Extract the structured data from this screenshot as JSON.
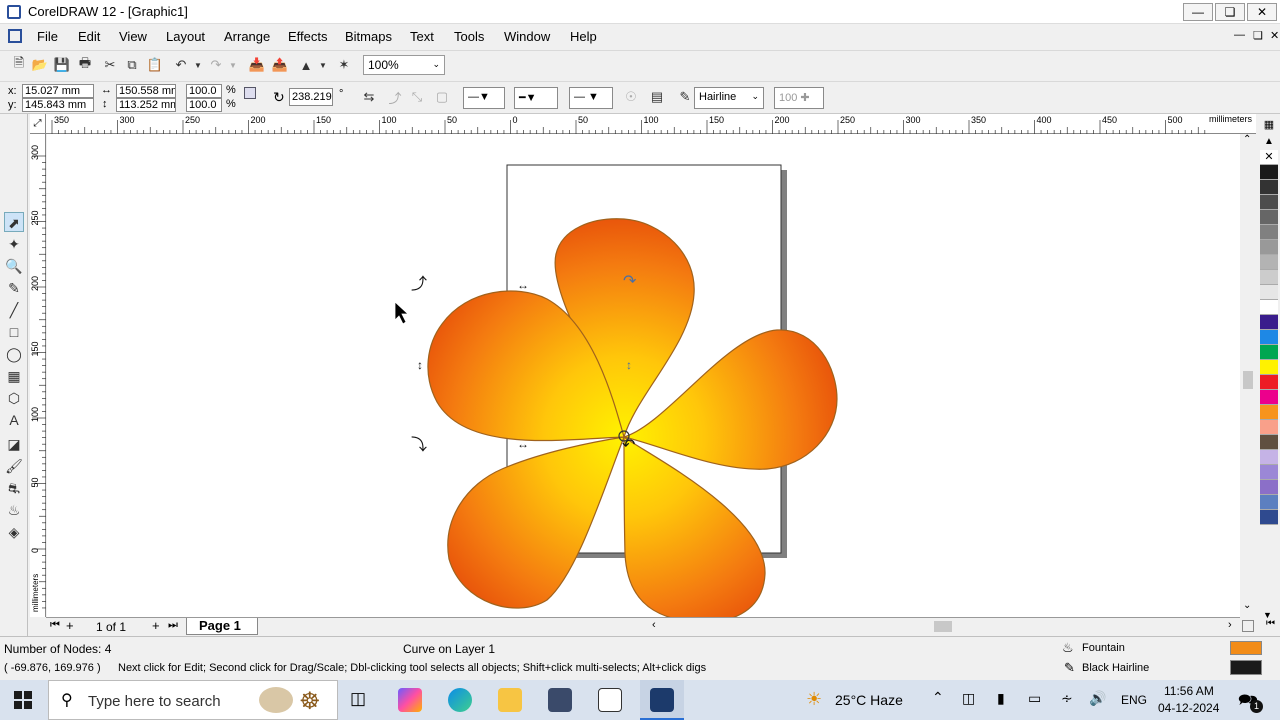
{
  "window": {
    "title": "CorelDRAW 12 - [Graphic1]"
  },
  "menu": [
    "File",
    "Edit",
    "View",
    "Layout",
    "Arrange",
    "Effects",
    "Bitmaps",
    "Text",
    "Tools",
    "Window",
    "Help"
  ],
  "toolbar": {
    "zoom": "100%"
  },
  "props": {
    "x": "15.027 mm",
    "y": "145.843 mm",
    "w": "150.558 mm",
    "h": "113.252 mm",
    "sx": "100.0",
    "sy": "100.0",
    "pct": "%",
    "angle": "238.219",
    "deg": "°",
    "outline": "Hairline",
    "num": "100"
  },
  "ruler": {
    "h_labels": [
      "350",
      "300",
      "250",
      "200",
      "150",
      "100",
      "50",
      "0",
      "50",
      "100",
      "150",
      "200",
      "250",
      "300",
      "350",
      "400",
      "450",
      "500"
    ],
    "h_unit": "millimeters",
    "v_labels": [
      "300",
      "250",
      "200",
      "150",
      "100",
      "50",
      "0"
    ],
    "v_unit": "millimeters"
  },
  "pages": {
    "count": "1 of 1",
    "tab": "Page 1"
  },
  "status": {
    "nodes": "Number of Nodes: 4",
    "object": "Curve on Layer 1",
    "coords": "( -69.876, 169.976 )",
    "hint": "Next click for Edit; Second click for Drag/Scale; Dbl-clicking tool selects all objects; Shift+click multi-selects; Alt+click digs",
    "fill_label": "Fountain",
    "outline_label": "Black  Hairline",
    "fill_color": "#f28c18",
    "outline_color": "#1a1a1a"
  },
  "palette": [
    "#ffffff",
    "#1a1a1a",
    "#333333",
    "#4d4d4d",
    "#666666",
    "#808080",
    "#999999",
    "#b3b3b3",
    "#cccccc",
    "#e6e6e6",
    "#ffffff",
    "#3a1d8c",
    "#1e88e5",
    "#00a651",
    "#fff200",
    "#ed1c24",
    "#ec008c",
    "#f7941d",
    "#f9a08a",
    "#605040",
    "#c5b3e6",
    "#9b87d6",
    "#8b6fc8",
    "#5c7fc0",
    "#2f4a8f"
  ],
  "taskbar": {
    "search": "Type here to search",
    "weather": "25°C  Haze",
    "lang": "ENG",
    "time": "11:56 AM",
    "date": "04-12-2024",
    "notif": "1"
  }
}
